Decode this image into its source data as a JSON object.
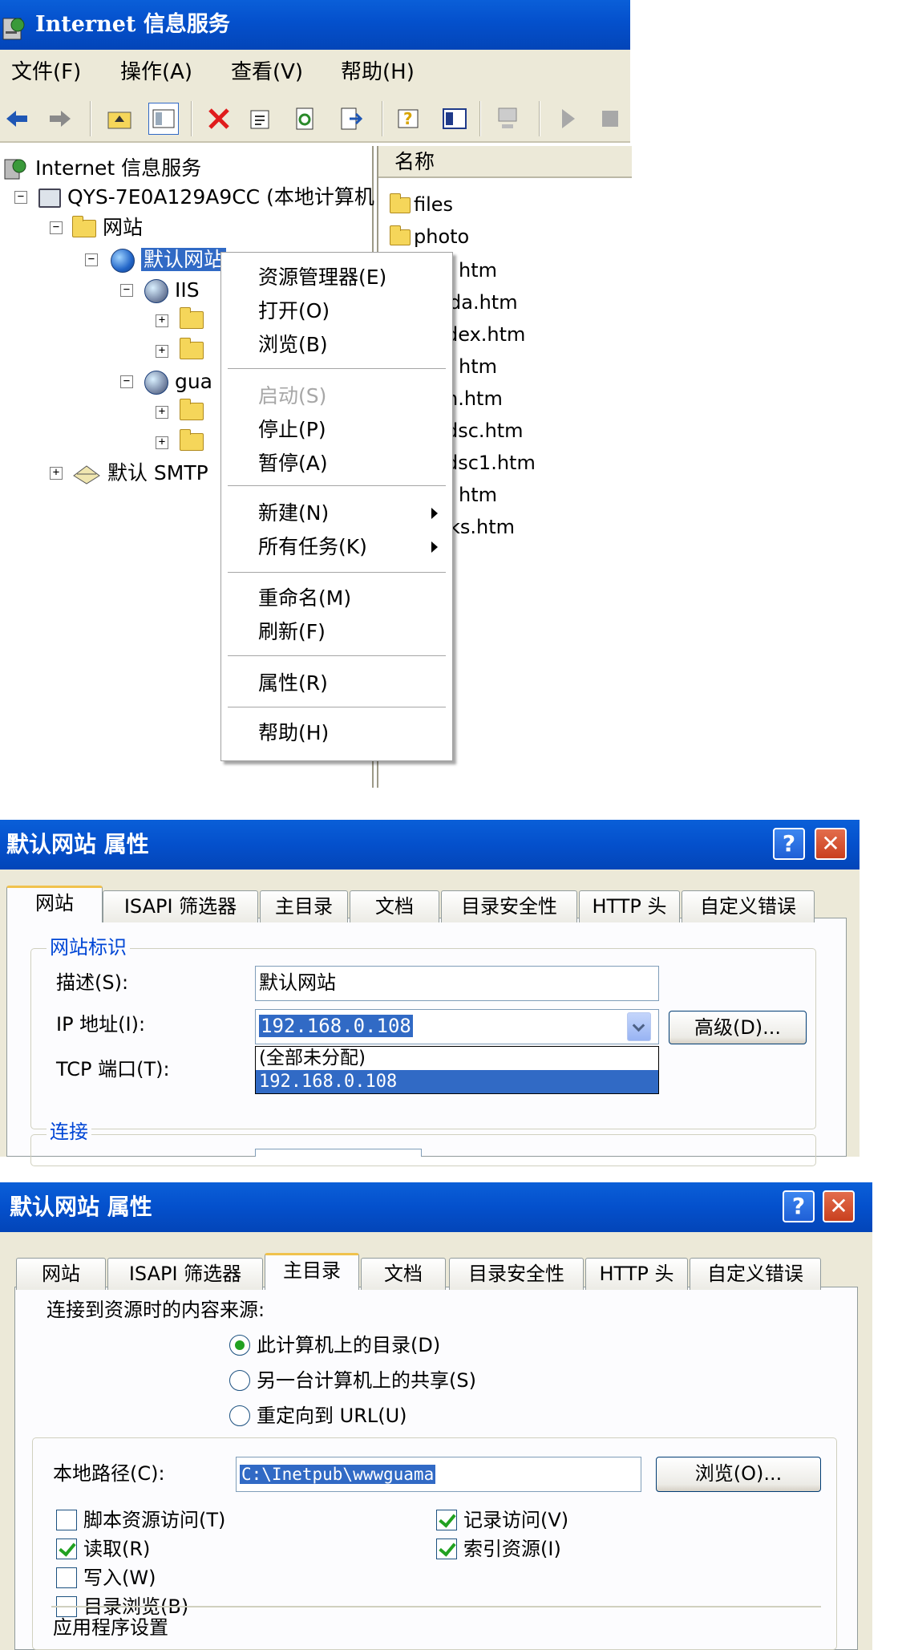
{
  "iis": {
    "title": "Internet 信息服务",
    "menu": [
      "文件(F)",
      "操作(A)",
      "查看(V)",
      "帮助(H)"
    ],
    "tree": {
      "root": "Internet 信息服务",
      "computer": "QYS-7E0A129A9CC (本地计算机",
      "websites": "网站",
      "default_site": "默认网站",
      "iis_node": "IIS",
      "gua_node": "gua",
      "smtp": "默认 SMTP"
    },
    "list_header": "名称",
    "list_items": [
      "files",
      "photo",
      "htm",
      "da.htm",
      "dex.htm",
      "htm",
      "h.htm",
      "dsc.htm",
      "dsc1.htm",
      "htm",
      "ks.htm"
    ],
    "context_menu": {
      "explorer": "资源管理器(E)",
      "open": "打开(O)",
      "browse": "浏览(B)",
      "start": "启动(S)",
      "stop": "停止(P)",
      "pause": "暂停(A)",
      "new": "新建(N)",
      "all_tasks": "所有任务(K)",
      "rename": "重命名(M)",
      "refresh": "刷新(F)",
      "properties": "属性(R)",
      "help": "帮助(H)"
    }
  },
  "dialog1": {
    "title": "默认网站 属性",
    "tabs": [
      "网站",
      "ISAPI 筛选器",
      "主目录",
      "文档",
      "目录安全性",
      "HTTP 头",
      "自定义错误"
    ],
    "group_site": "网站标识",
    "desc_label": "描述(S):",
    "desc_value": "默认网站",
    "ip_label": "IP 地址(I):",
    "ip_value": "192.168.0.108",
    "advanced_button": "高级(D)...",
    "tcp_label": "TCP 端口(T):",
    "dropdown_options": [
      "(全部未分配)",
      "192.168.0.108"
    ],
    "group_connect": "连接"
  },
  "dialog2": {
    "title": "默认网站 属性",
    "tabs": [
      "网站",
      "ISAPI 筛选器",
      "主目录",
      "文档",
      "目录安全性",
      "HTTP 头",
      "自定义错误"
    ],
    "source_label": "连接到资源时的内容来源:",
    "radio_local": "此计算机上的目录(D)",
    "radio_share": "另一台计算机上的共享(S)",
    "radio_url": "重定向到 URL(U)",
    "path_label": "本地路径(C):",
    "path_value": "C:\\Inetpub\\wwwguama",
    "browse_button": "浏览(O)...",
    "chk_script": "脚本资源访问(T)",
    "chk_read": "读取(R)",
    "chk_write": "写入(W)",
    "chk_dirbrowse": "目录浏览(B)",
    "chk_log": "记录访问(V)",
    "chk_index": "索引资源(I)",
    "app_settings": "应用程序设置"
  }
}
